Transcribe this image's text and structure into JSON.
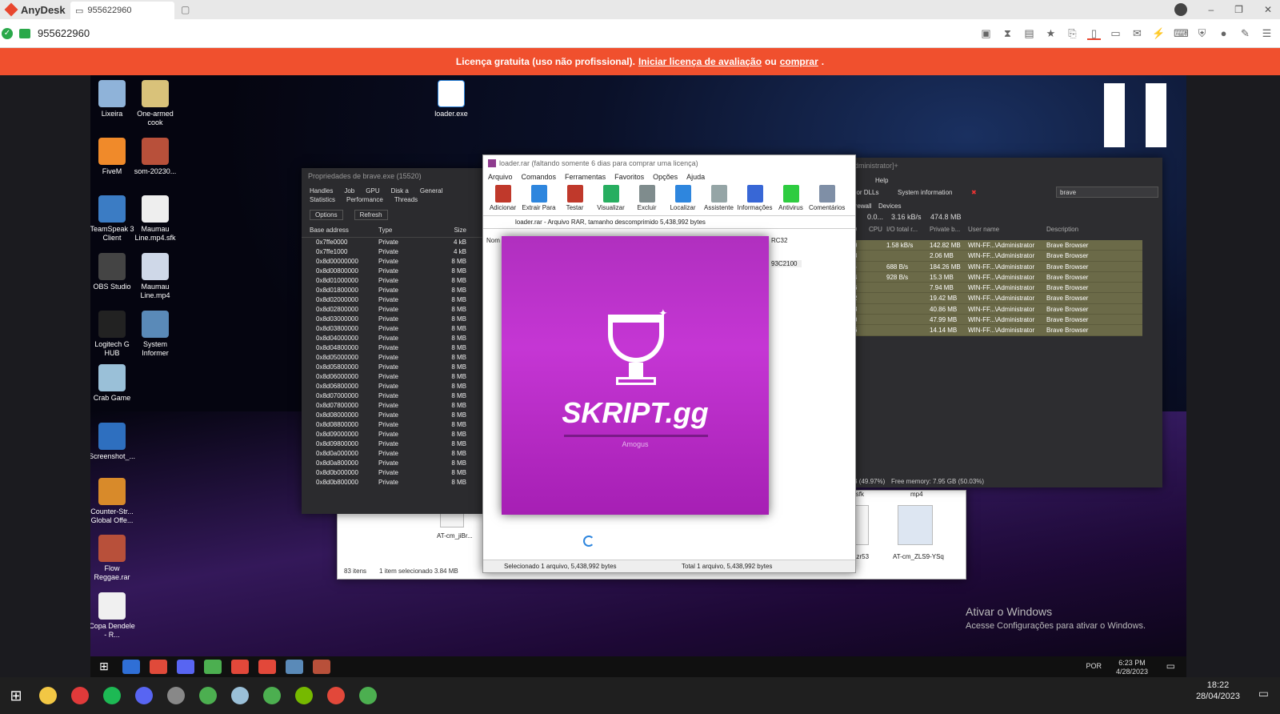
{
  "anydesk": {
    "app_title": "AnyDesk",
    "tab_address": "955622960",
    "address": "955622960",
    "window_controls": [
      "–",
      "❐",
      "✕"
    ]
  },
  "banner": {
    "text_before": "Licença gratuita (uso não profissional).",
    "link1": "Iniciar licença de avaliação",
    "mid": "ou",
    "link2": "comprar",
    "after": "."
  },
  "desktop": {
    "icons_left": [
      {
        "label": "Lixeira",
        "color": "#8fb3d9"
      },
      {
        "label": "One-armed cook",
        "color": "#d9c27a"
      },
      {
        "label": "FiveM",
        "color": "#f08a2a"
      },
      {
        "label": "som-20230...",
        "color": "#b8503a"
      },
      {
        "label": "TeamSpeak 3 Client",
        "color": "#3b7cc4"
      },
      {
        "label": "Maumau Line.mp4.sfk",
        "color": "#eeeeee"
      },
      {
        "label": "OBS Studio",
        "color": "#444444"
      },
      {
        "label": "Maumau Line.mp4",
        "color": "#cfd8e8"
      },
      {
        "label": "Logitech G HUB",
        "color": "#222222"
      },
      {
        "label": "System Informer",
        "color": "#5a8ab8"
      },
      {
        "label": "Crab Game",
        "color": "#9ac0d8"
      },
      {
        "label": "Screenshot_...",
        "color": "#2e6fbf"
      },
      {
        "label": "Counter-Str... Global Offe...",
        "color": "#d88a2a"
      },
      {
        "label": "Flow Reggae.rar",
        "color": "#b8503a"
      },
      {
        "label": "Copa Dendele - R...",
        "color": "#f0f0f0"
      }
    ],
    "loader_icon": "loader.exe",
    "activate_title": "Ativar o Windows",
    "activate_sub": "Acesse Configurações para ativar o Windows."
  },
  "props_window": {
    "title": "Propriedades de brave.exe (15520)",
    "tabs": [
      "Handles",
      "Job",
      "GPU",
      "Disk a",
      "General",
      "Statistics",
      "Performance",
      "Threads"
    ],
    "buttons": [
      "Options",
      "Refresh"
    ],
    "headers": [
      "Base address",
      "Type",
      "Size"
    ],
    "rows": [
      [
        "0x7ffe0000",
        "Private",
        "4 kB"
      ],
      [
        "0x7ffe1000",
        "Private",
        "4 kB"
      ],
      [
        "0x8d00000000",
        "Private",
        "8 MB"
      ],
      [
        "0x8d00800000",
        "Private",
        "8 MB"
      ],
      [
        "0x8d01000000",
        "Private",
        "8 MB"
      ],
      [
        "0x8d01800000",
        "Private",
        "8 MB"
      ],
      [
        "0x8d02000000",
        "Private",
        "8 MB"
      ],
      [
        "0x8d02800000",
        "Private",
        "8 MB"
      ],
      [
        "0x8d03000000",
        "Private",
        "8 MB"
      ],
      [
        "0x8d03800000",
        "Private",
        "8 MB"
      ],
      [
        "0x8d04000000",
        "Private",
        "8 MB"
      ],
      [
        "0x8d04800000",
        "Private",
        "8 MB"
      ],
      [
        "0x8d05000000",
        "Private",
        "8 MB"
      ],
      [
        "0x8d05800000",
        "Private",
        "8 MB"
      ],
      [
        "0x8d06000000",
        "Private",
        "8 MB"
      ],
      [
        "0x8d06800000",
        "Private",
        "8 MB"
      ],
      [
        "0x8d07000000",
        "Private",
        "8 MB"
      ],
      [
        "0x8d07800000",
        "Private",
        "8 MB"
      ],
      [
        "0x8d08000000",
        "Private",
        "8 MB"
      ],
      [
        "0x8d08800000",
        "Private",
        "8 MB"
      ],
      [
        "0x8d09000000",
        "Private",
        "8 MB"
      ],
      [
        "0x8d09800000",
        "Private",
        "8 MB"
      ],
      [
        "0x8d0a000000",
        "Private",
        "8 MB"
      ],
      [
        "0x8d0a800000",
        "Private",
        "8 MB"
      ],
      [
        "0x8d0b000000",
        "Private",
        "8 MB"
      ],
      [
        "0x8d0b800000",
        "Private",
        "8 MB"
      ]
    ]
  },
  "process_hacker": {
    "title": "Administrator]+",
    "menu": "Help",
    "toolbar_left": "les or DLLs",
    "toolbar_sysinfo": "System information",
    "search": "brave",
    "tabs": [
      "Firewall",
      "Devices"
    ],
    "stats": [
      "0.0...",
      "3.16 kB/s",
      "474.8 MB"
    ],
    "headers": [
      "PID",
      "CPU",
      "I/O total r...",
      "Private b...",
      "User name",
      "Description"
    ],
    "rows": [
      [
        "520",
        "",
        "1.58 kB/s",
        "142.82 MB",
        "WIN-FF...\\Administrator",
        "Brave Browser"
      ],
      [
        "268",
        "",
        "",
        "2.06 MB",
        "WIN-FF...\\Administrator",
        "Brave Browser"
      ],
      [
        "116",
        "",
        "688 B/s",
        "184.26 MB",
        "WIN-FF...\\Administrator",
        "Brave Browser"
      ],
      [
        "904",
        "",
        "928 B/s",
        "15.3 MB",
        "WIN-FF...\\Administrator",
        "Brave Browser"
      ],
      [
        "756",
        "",
        "",
        "7.94 MB",
        "WIN-FF...\\Administrator",
        "Brave Browser"
      ],
      [
        "532",
        "",
        "",
        "19.42 MB",
        "WIN-FF...\\Administrator",
        "Brave Browser"
      ],
      [
        "148",
        "",
        "",
        "40.86 MB",
        "WIN-FF...\\Administrator",
        "Brave Browser"
      ],
      [
        "480",
        "",
        "",
        "47.99 MB",
        "WIN-FF...\\Administrator",
        "Brave Browser"
      ],
      [
        "176",
        "",
        "",
        "14.14 MB",
        "WIN-FF...\\Administrator",
        "Brave Browser"
      ]
    ],
    "footer_mem": "GB (49.97%)",
    "footer_free": "Free memory: 7.95 GB (50.03%)"
  },
  "winrar": {
    "title": "loader.rar (faltando somente 6 dias para comprar uma licença)",
    "menu": [
      "Arquivo",
      "Comandos",
      "Ferramentas",
      "Favoritos",
      "Opções",
      "Ajuda"
    ],
    "tools": [
      {
        "label": "Adicionar",
        "color": "#c0392b"
      },
      {
        "label": "Extrair Para",
        "color": "#2e86de"
      },
      {
        "label": "Testar",
        "color": "#c0392b"
      },
      {
        "label": "Visualizar",
        "color": "#27ae60"
      },
      {
        "label": "Excluir",
        "color": "#7f8c8d"
      },
      {
        "label": "Localizar",
        "color": "#2e86de"
      },
      {
        "label": "Assistente",
        "color": "#95a5a6"
      },
      {
        "label": "Informações",
        "color": "#3867d6"
      },
      {
        "label": "Antivirus",
        "color": "#2ecc40"
      },
      {
        "label": "Comentários",
        "color": "#7f8fa6"
      }
    ],
    "path": "loader.rar - Arquivo RAR, tamanho descomprimido 5,438,992 bytes",
    "col_name": "Nom",
    "crc_col": "RC32",
    "crc_val": "93C2100",
    "status_left": "Selecionado 1 arquivo, 5,438,992 bytes",
    "status_right": "Total 1 arquivo, 5,438,992 bytes"
  },
  "splash": {
    "name": "SKRIPT.gg",
    "sub": "Amogus"
  },
  "explorer": {
    "items_count": "83 itens",
    "selected": "1 item selecionado  3.84 MB",
    "file1": "AT-cm_jiBr...",
    "file2": "mp4.sfk",
    "file3": "mp4",
    "file4": "_xtdAzr53",
    "file5": "AT-cm_ZLS9-YSq"
  },
  "remote_taskbar": {
    "clock_time": "6:23 PM",
    "clock_date": "4/28/2023",
    "lang": "POR",
    "icons": [
      "#2f6fd6",
      "#e04a3a",
      "#5865f2",
      "#4caf50",
      "#e2483a",
      "#e2483a",
      "#5a8ab8",
      "#b8503a"
    ]
  },
  "local_taskbar": {
    "clock_time": "18:22",
    "clock_date": "28/04/2023",
    "icons": [
      "#f2c744",
      "#e03a3a",
      "#1db954",
      "#5865f2",
      "#888888",
      "#4caf50",
      "#9ac0d8",
      "#4caf50",
      "#76b900",
      "#e2483a",
      "#4caf50"
    ]
  }
}
